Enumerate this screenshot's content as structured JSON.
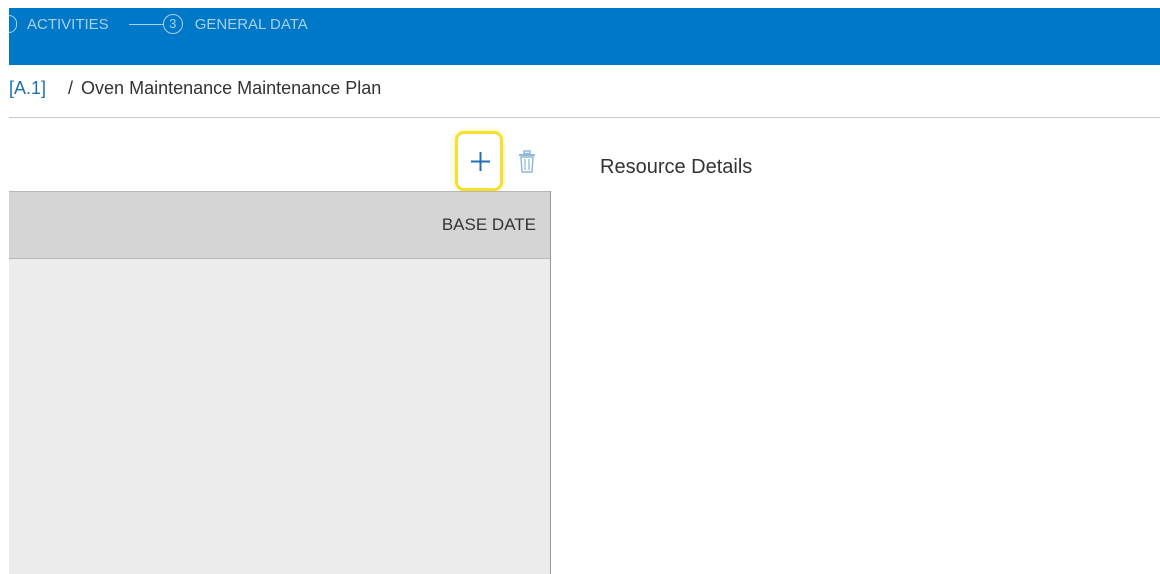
{
  "stepper": {
    "steps": [
      {
        "number": "",
        "label": "ACTIVITIES"
      },
      {
        "number": "3",
        "label": "GENERAL DATA"
      }
    ]
  },
  "breadcrumb": {
    "link": "[A.1]",
    "separator": "/",
    "current": "Oven Maintenance Maintenance Plan"
  },
  "grid": {
    "columns": [
      "BASE DATE"
    ]
  },
  "details": {
    "title": "Resource Details"
  },
  "colors": {
    "header_bg": "#0078c8",
    "highlight": "#f6df2f",
    "icon_blue": "#1f6fb2",
    "icon_muted": "#8fb9d9"
  },
  "icons": {
    "add": "plus-icon",
    "delete": "trash-icon"
  }
}
